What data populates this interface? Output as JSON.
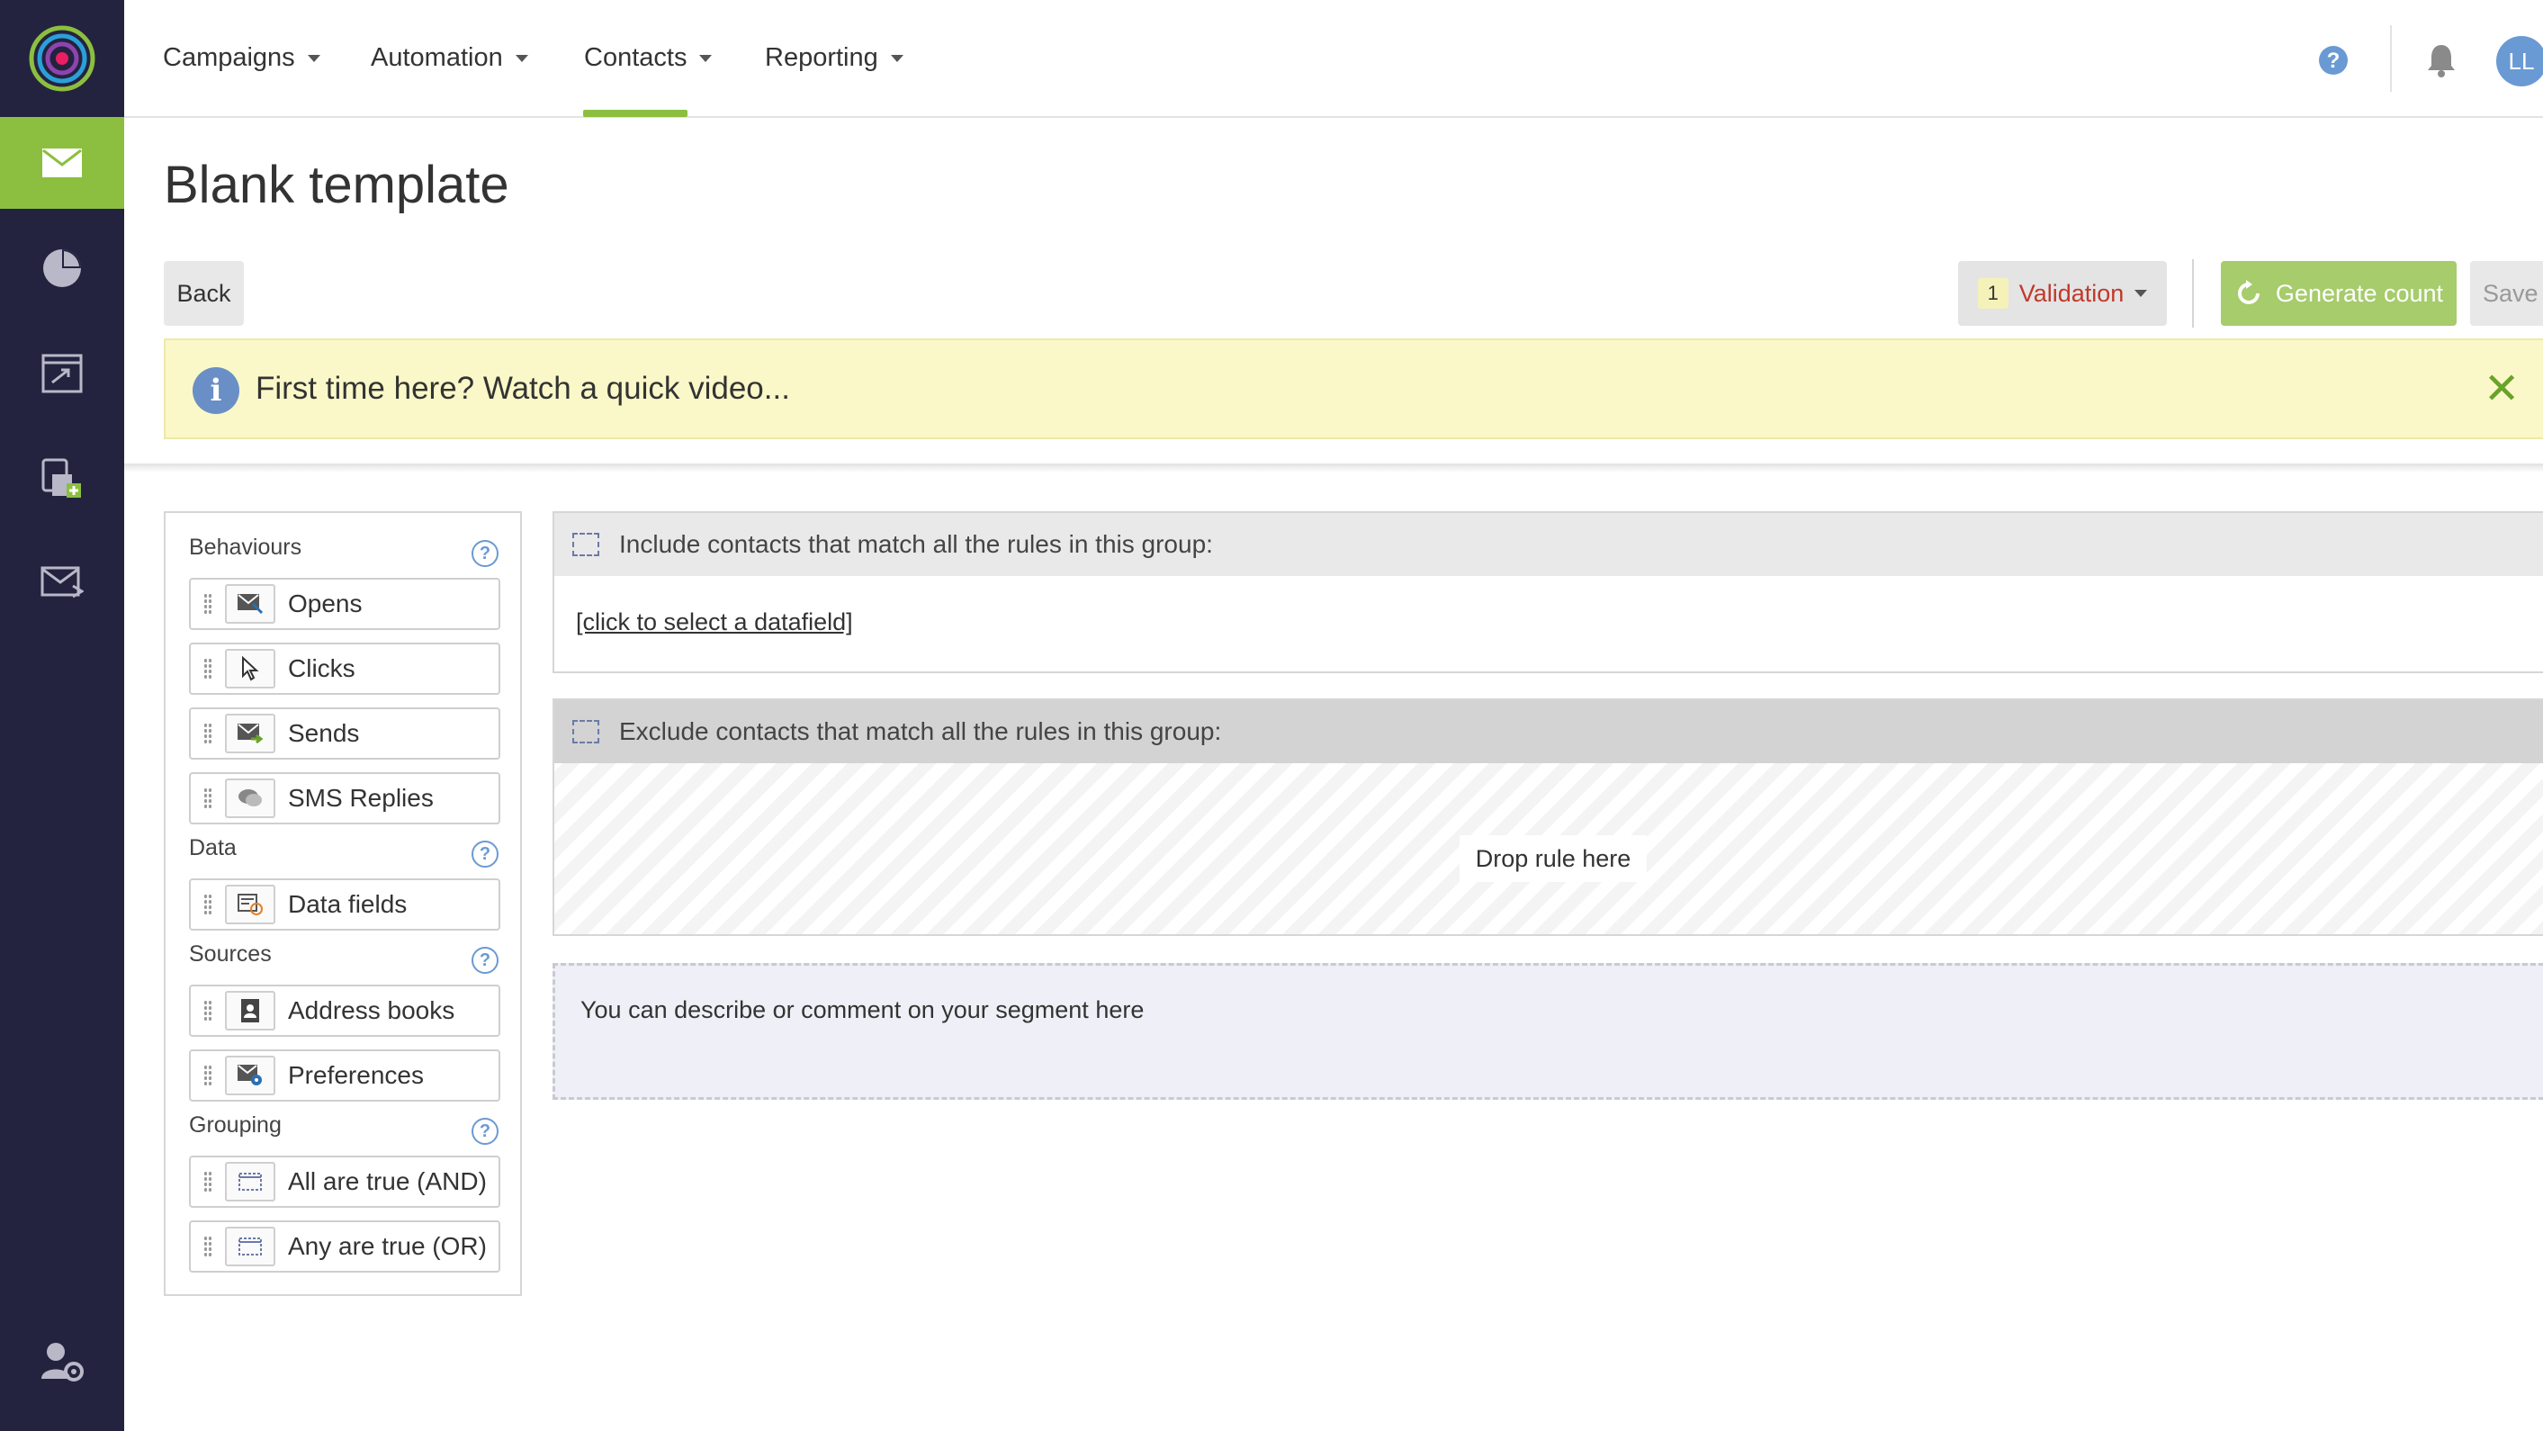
{
  "nav": {
    "items": [
      {
        "label": "Campaigns"
      },
      {
        "label": "Automation"
      },
      {
        "label": "Contacts"
      },
      {
        "label": "Reporting"
      }
    ],
    "active": "Contacts",
    "avatar_initials": "LL"
  },
  "rail": {
    "items": [
      "email-icon",
      "pie-chart-icon",
      "automation-program-icon",
      "contacts-add-icon",
      "mail-forward-icon",
      "user-settings-icon"
    ],
    "active": "email-icon",
    "accent_color": "#8cbf3f"
  },
  "page": {
    "title": "Blank template"
  },
  "toolbar": {
    "back_label": "Back",
    "validation_count": "1",
    "validation_label": "Validation",
    "generate_label": "Generate count",
    "save_label": "Save"
  },
  "banner": {
    "text": "First time here? Watch a quick video..."
  },
  "palette": {
    "sections": [
      {
        "heading": "Behaviours",
        "items": [
          "Opens",
          "Clicks",
          "Sends",
          "SMS Replies"
        ]
      },
      {
        "heading": "Data",
        "items": [
          "Data fields"
        ]
      },
      {
        "heading": "Sources",
        "items": [
          "Address books",
          "Preferences"
        ]
      },
      {
        "heading": "Grouping",
        "items": [
          "All are true (AND)",
          "Any are true (OR)"
        ]
      }
    ]
  },
  "rules": {
    "include_title": "Include contacts that match all the rules in this group:",
    "include_link": "[click to select a datafield]",
    "exclude_title": "Exclude contacts that match all the rules in this group:",
    "drop_label": "Drop rule here",
    "comment_placeholder": "You can describe or comment on your segment here"
  }
}
